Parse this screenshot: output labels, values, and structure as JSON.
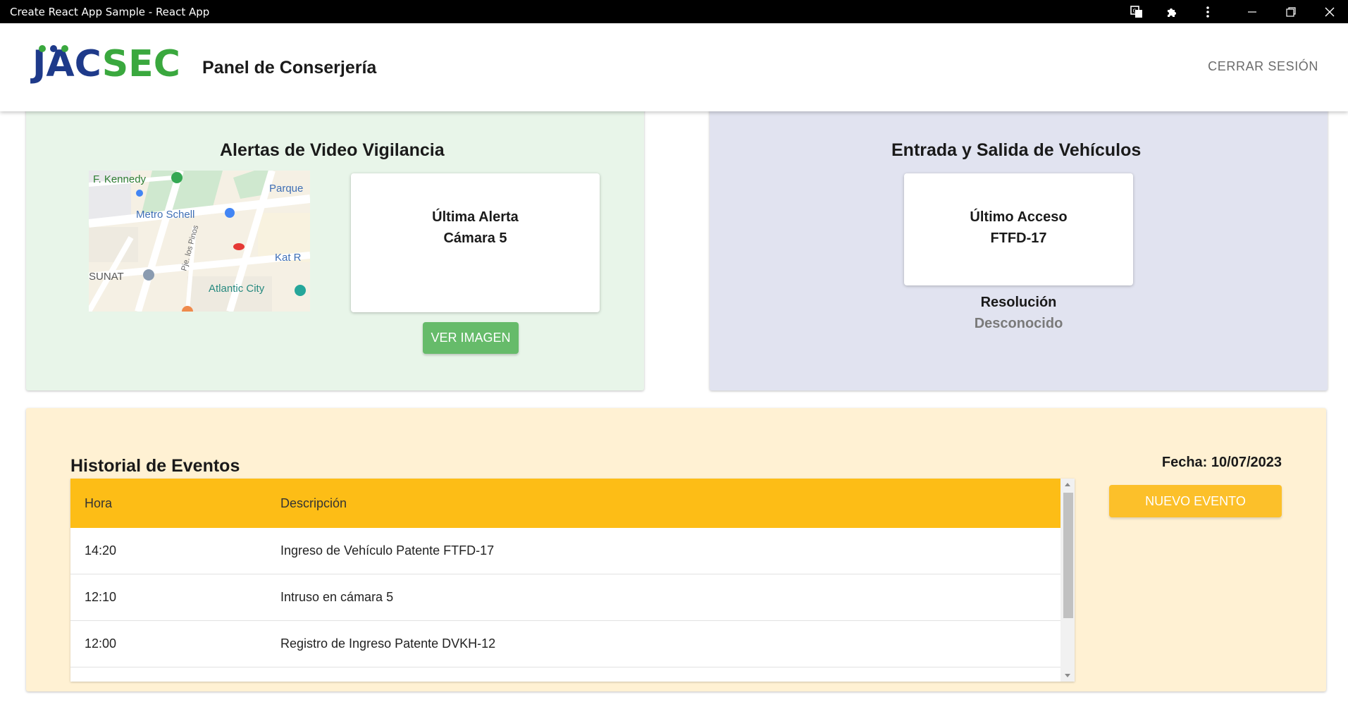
{
  "window": {
    "title": "Create React App Sample - React App"
  },
  "header": {
    "logo_part1": "JAC",
    "logo_part2": "SEC",
    "title": "Panel de Conserjería",
    "logout_label": "CERRAR SESIÓN"
  },
  "video_panel": {
    "title": "Alertas de Video Vigilancia",
    "card_line1": "Última Alerta",
    "card_line2": "Cámara 5",
    "button_label": "VER IMAGEN",
    "map_labels": {
      "kennedy": "F. Kennedy",
      "parque": "Parque",
      "metro": "Metro Schell",
      "pje": "Pje. los Pinos",
      "kat": "Kat R",
      "sunat": "SUNAT",
      "atlantic": "Atlantic City"
    }
  },
  "vehicle_panel": {
    "title": "Entrada y Salida de Vehículos",
    "card_line1": "Último Acceso",
    "card_line2": "FTFD-17",
    "resolution_label": "Resolución",
    "resolution_value": "Desconocido"
  },
  "events_panel": {
    "title": "Historial de Eventos",
    "date_label": "Fecha: 10/07/2023",
    "button_label": "NUEVO EVENTO",
    "columns": [
      "Hora",
      "Descripción"
    ],
    "rows": [
      {
        "time": "14:20",
        "description": "Ingreso de Vehículo Patente FTFD-17"
      },
      {
        "time": "12:10",
        "description": "Intruso en cámara 5"
      },
      {
        "time": "12:00",
        "description": "Registro de Ingreso Patente DVKH-12"
      }
    ]
  },
  "colors": {
    "video_bg": "#e8f5e9",
    "vehicle_bg": "#e1e3f0",
    "events_bg": "#fff1d3",
    "green_button": "#66bb6a",
    "yellow_button": "#fcc02a",
    "table_header": "#fdbd16",
    "logo_blue": "#1e3a8a",
    "logo_green": "#3aa83e"
  }
}
